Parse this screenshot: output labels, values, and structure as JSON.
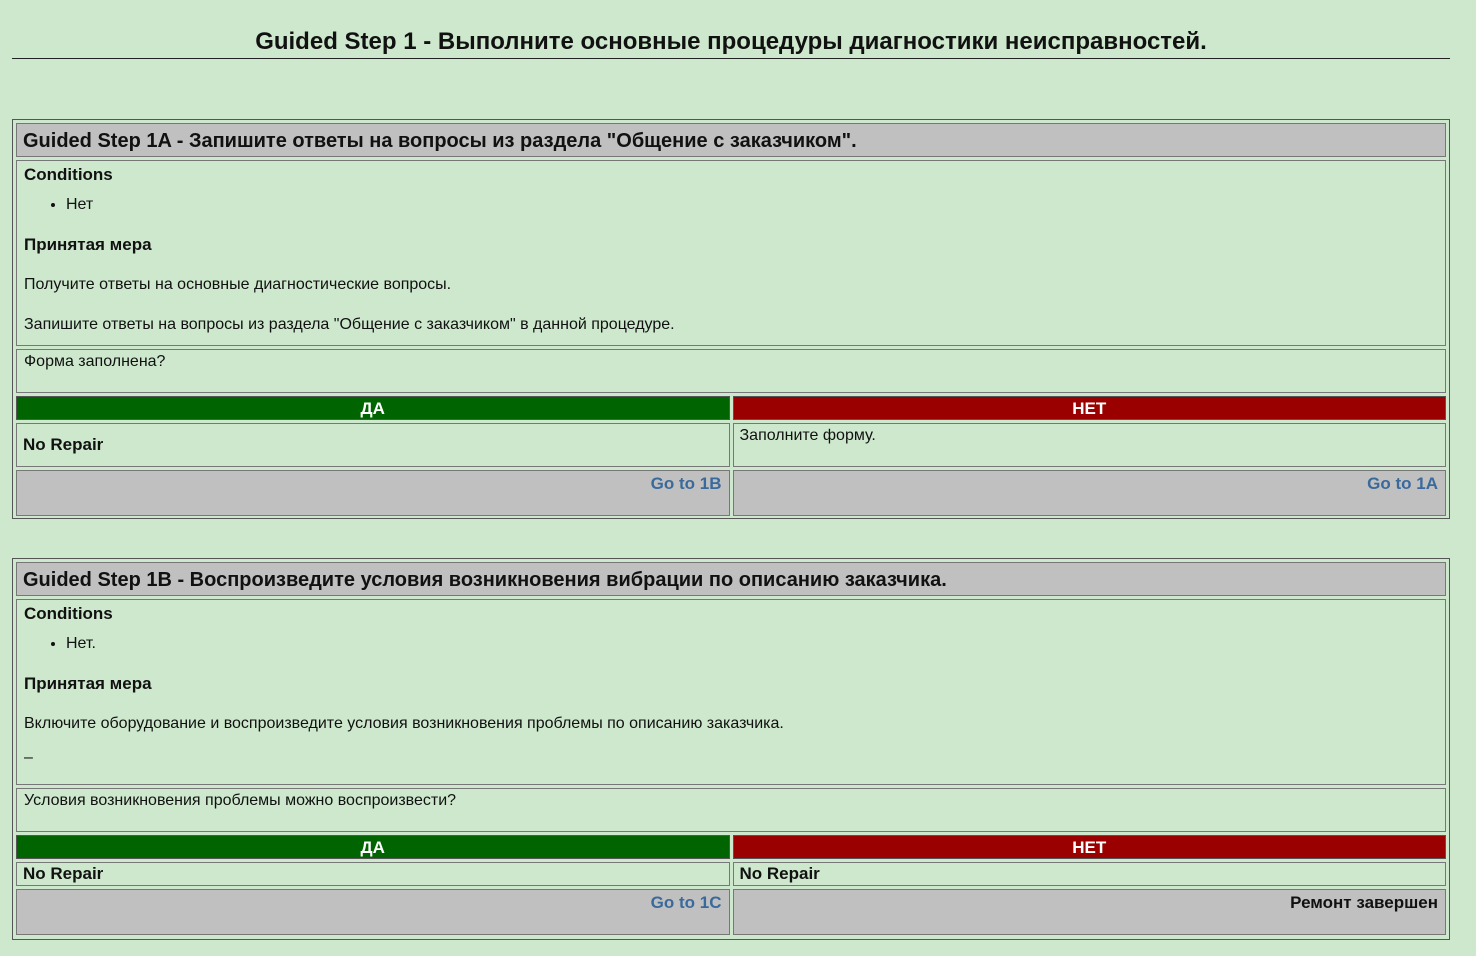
{
  "page": {
    "title": "Guided Step 1 - Выполните основные процедуры диагностики неисправностей."
  },
  "step_1a": {
    "title": "Guided Step 1A - Запишите ответы на вопросы из раздела \"Общение с заказчиком\".",
    "conditions_label": "Conditions",
    "conditions": [
      "Нет"
    ],
    "action_label": "Принятая мера",
    "action_text_1": "Получите ответы на основные диагностические вопросы.",
    "action_text_2": "Запишите ответы на вопросы из раздела \"Общение с заказчиком\" в данной процедуре.",
    "question": "Форма заполнена?",
    "yes_label": "ДА",
    "no_label": "НЕТ",
    "yes_result": "No Repair",
    "no_result": "Заполните форму.",
    "yes_link": "Go to 1B",
    "no_link": "Go to 1A"
  },
  "step_1b": {
    "title": "Guided Step 1B - Воспроизведите условия возникновения вибрации по описанию заказчика.",
    "conditions_label": "Conditions",
    "conditions": [
      "Нет."
    ],
    "action_label": "Принятая мера",
    "action_text_1": "Включите оборудование и воспроизведите условия возникновения проблемы по описанию заказчика.",
    "action_text_2": "–",
    "question": "Условия возникновения проблемы можно воспроизвести?",
    "yes_label": "ДА",
    "no_label": "НЕТ",
    "yes_result": "No Repair",
    "no_result": "No Repair",
    "yes_link": "Go to 1C",
    "no_status": "Ремонт завершен"
  }
}
